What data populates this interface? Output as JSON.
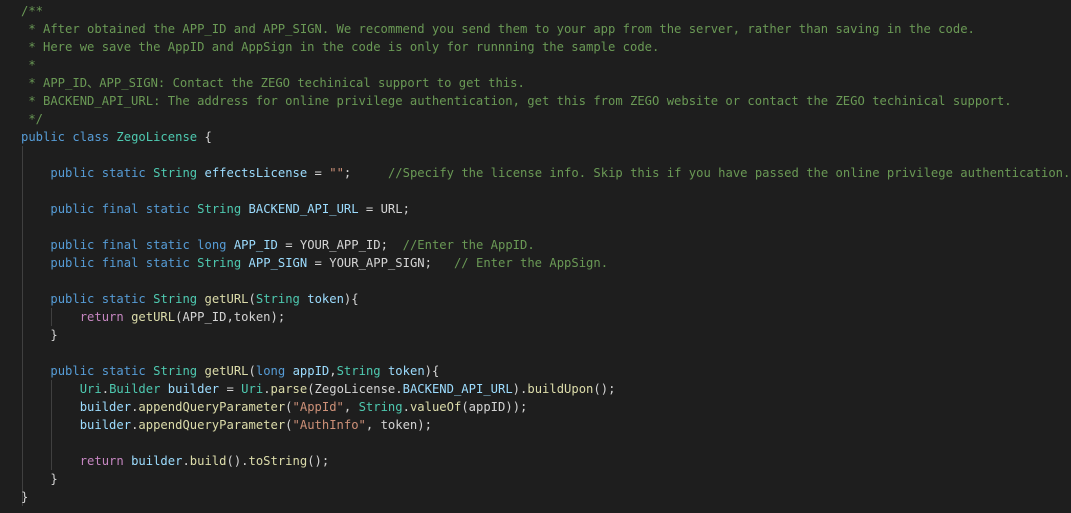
{
  "editor": {
    "language": "java",
    "lines": [
      [
        [
          "c",
          "/**"
        ]
      ],
      [
        [
          "c",
          " * After obtained the APP_ID and APP_SIGN. We recommend you send them to your app from the server, rather than saving in the code."
        ]
      ],
      [
        [
          "c",
          " * Here we save the AppID and AppSign in the code is only for runnning the sample code."
        ]
      ],
      [
        [
          "c",
          " *"
        ]
      ],
      [
        [
          "c",
          " * APP_ID、APP_SIGN: Contact the ZEGO techinical support to get this."
        ]
      ],
      [
        [
          "c",
          " * BACKEND_API_URL: The address for online privilege authentication, get this from ZEGO website or contact the ZEGO techinical support."
        ]
      ],
      [
        [
          "c",
          " */"
        ]
      ],
      [
        [
          "k",
          "public"
        ],
        [
          "p",
          " "
        ],
        [
          "k",
          "class"
        ],
        [
          "p",
          " "
        ],
        [
          "t",
          "ZegoLicense"
        ],
        [
          "p",
          " {"
        ]
      ],
      [],
      [
        [
          "p",
          "    "
        ],
        [
          "k",
          "public"
        ],
        [
          "p",
          " "
        ],
        [
          "k",
          "static"
        ],
        [
          "p",
          " "
        ],
        [
          "t",
          "String"
        ],
        [
          "p",
          " "
        ],
        [
          "v",
          "effectsLicense"
        ],
        [
          "p",
          " = "
        ],
        [
          "s",
          "\"\""
        ],
        [
          "p",
          ";     "
        ],
        [
          "c",
          "//Specify the license info. Skip this if you have passed the online privilege authentication."
        ]
      ],
      [],
      [
        [
          "p",
          "    "
        ],
        [
          "k",
          "public"
        ],
        [
          "p",
          " "
        ],
        [
          "k",
          "final"
        ],
        [
          "p",
          " "
        ],
        [
          "k",
          "static"
        ],
        [
          "p",
          " "
        ],
        [
          "t",
          "String"
        ],
        [
          "p",
          " "
        ],
        [
          "v",
          "BACKEND_API_URL"
        ],
        [
          "p",
          " = URL;"
        ]
      ],
      [],
      [
        [
          "p",
          "    "
        ],
        [
          "k",
          "public"
        ],
        [
          "p",
          " "
        ],
        [
          "k",
          "final"
        ],
        [
          "p",
          " "
        ],
        [
          "k",
          "static"
        ],
        [
          "p",
          " "
        ],
        [
          "k",
          "long"
        ],
        [
          "p",
          " "
        ],
        [
          "v",
          "APP_ID"
        ],
        [
          "p",
          " = YOUR_APP_ID;  "
        ],
        [
          "c",
          "//Enter the AppID."
        ]
      ],
      [
        [
          "p",
          "    "
        ],
        [
          "k",
          "public"
        ],
        [
          "p",
          " "
        ],
        [
          "k",
          "final"
        ],
        [
          "p",
          " "
        ],
        [
          "k",
          "static"
        ],
        [
          "p",
          " "
        ],
        [
          "t",
          "String"
        ],
        [
          "p",
          " "
        ],
        [
          "v",
          "APP_SIGN"
        ],
        [
          "p",
          " = YOUR_APP_SIGN;   "
        ],
        [
          "c",
          "// Enter the AppSign."
        ]
      ],
      [],
      [
        [
          "p",
          "    "
        ],
        [
          "k",
          "public"
        ],
        [
          "p",
          " "
        ],
        [
          "k",
          "static"
        ],
        [
          "p",
          " "
        ],
        [
          "t",
          "String"
        ],
        [
          "p",
          " "
        ],
        [
          "f",
          "getURL"
        ],
        [
          "p",
          "("
        ],
        [
          "t",
          "String"
        ],
        [
          "p",
          " "
        ],
        [
          "v",
          "token"
        ],
        [
          "p",
          "){"
        ]
      ],
      [
        [
          "p",
          "        "
        ],
        [
          "kc",
          "return"
        ],
        [
          "p",
          " "
        ],
        [
          "f",
          "getURL"
        ],
        [
          "p",
          "(APP_ID,token);"
        ]
      ],
      [
        [
          "p",
          "    }"
        ]
      ],
      [],
      [
        [
          "p",
          "    "
        ],
        [
          "k",
          "public"
        ],
        [
          "p",
          " "
        ],
        [
          "k",
          "static"
        ],
        [
          "p",
          " "
        ],
        [
          "t",
          "String"
        ],
        [
          "p",
          " "
        ],
        [
          "f",
          "getURL"
        ],
        [
          "p",
          "("
        ],
        [
          "k",
          "long"
        ],
        [
          "p",
          " "
        ],
        [
          "v",
          "appID"
        ],
        [
          "p",
          ","
        ],
        [
          "t",
          "String"
        ],
        [
          "p",
          " "
        ],
        [
          "v",
          "token"
        ],
        [
          "p",
          "){"
        ]
      ],
      [
        [
          "p",
          "        "
        ],
        [
          "t",
          "Uri"
        ],
        [
          "p",
          "."
        ],
        [
          "t",
          "Builder"
        ],
        [
          "p",
          " "
        ],
        [
          "v",
          "builder"
        ],
        [
          "p",
          " = "
        ],
        [
          "t",
          "Uri"
        ],
        [
          "p",
          "."
        ],
        [
          "f",
          "parse"
        ],
        [
          "p",
          "(ZegoLicense."
        ],
        [
          "v",
          "BACKEND_API_URL"
        ],
        [
          "p",
          ")."
        ],
        [
          "f",
          "buildUpon"
        ],
        [
          "p",
          "();"
        ]
      ],
      [
        [
          "p",
          "        "
        ],
        [
          "v",
          "builder"
        ],
        [
          "p",
          "."
        ],
        [
          "f",
          "appendQueryParameter"
        ],
        [
          "p",
          "("
        ],
        [
          "s",
          "\"AppId\""
        ],
        [
          "p",
          ", "
        ],
        [
          "t",
          "String"
        ],
        [
          "p",
          "."
        ],
        [
          "f",
          "valueOf"
        ],
        [
          "p",
          "(appID));"
        ]
      ],
      [
        [
          "p",
          "        "
        ],
        [
          "v",
          "builder"
        ],
        [
          "p",
          "."
        ],
        [
          "f",
          "appendQueryParameter"
        ],
        [
          "p",
          "("
        ],
        [
          "s",
          "\"AuthInfo\""
        ],
        [
          "p",
          ", token);"
        ]
      ],
      [],
      [
        [
          "p",
          "        "
        ],
        [
          "kc",
          "return"
        ],
        [
          "p",
          " "
        ],
        [
          "v",
          "builder"
        ],
        [
          "p",
          "."
        ],
        [
          "f",
          "build"
        ],
        [
          "p",
          "()."
        ],
        [
          "f",
          "toString"
        ],
        [
          "p",
          "();"
        ]
      ],
      [
        [
          "p",
          "    }"
        ]
      ],
      [
        [
          "p",
          "}"
        ]
      ]
    ]
  }
}
